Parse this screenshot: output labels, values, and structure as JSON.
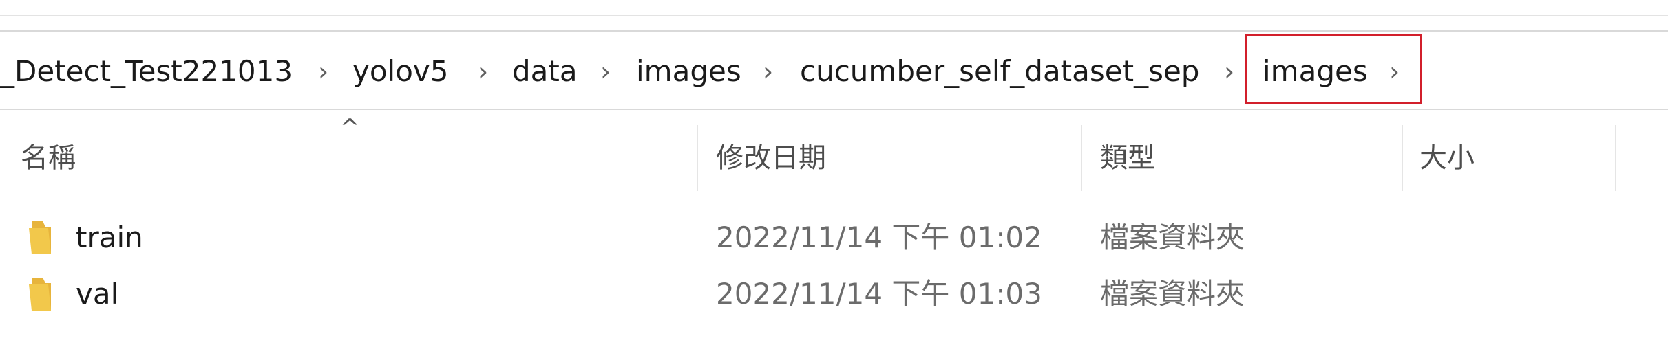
{
  "breadcrumb": {
    "items": [
      {
        "label": "_Detect_Test221013"
      },
      {
        "label": "yolov5"
      },
      {
        "label": "data"
      },
      {
        "label": "images"
      },
      {
        "label": "cucumber_self_dataset_sep"
      },
      {
        "label": "images"
      }
    ]
  },
  "columns": {
    "name": "名稱",
    "modified": "修改日期",
    "type": "類型",
    "size": "大小"
  },
  "files": [
    {
      "name": "train",
      "modified": "2022/11/14 下午 01:02",
      "type": "檔案資料夾",
      "size": "",
      "icon": "folder-icon"
    },
    {
      "name": "val",
      "modified": "2022/11/14 下午 01:03",
      "type": "檔案資料夾",
      "size": "",
      "icon": "folder-icon"
    }
  ],
  "colors": {
    "highlight": "#d21f2b",
    "folder": "#f2c84b"
  }
}
